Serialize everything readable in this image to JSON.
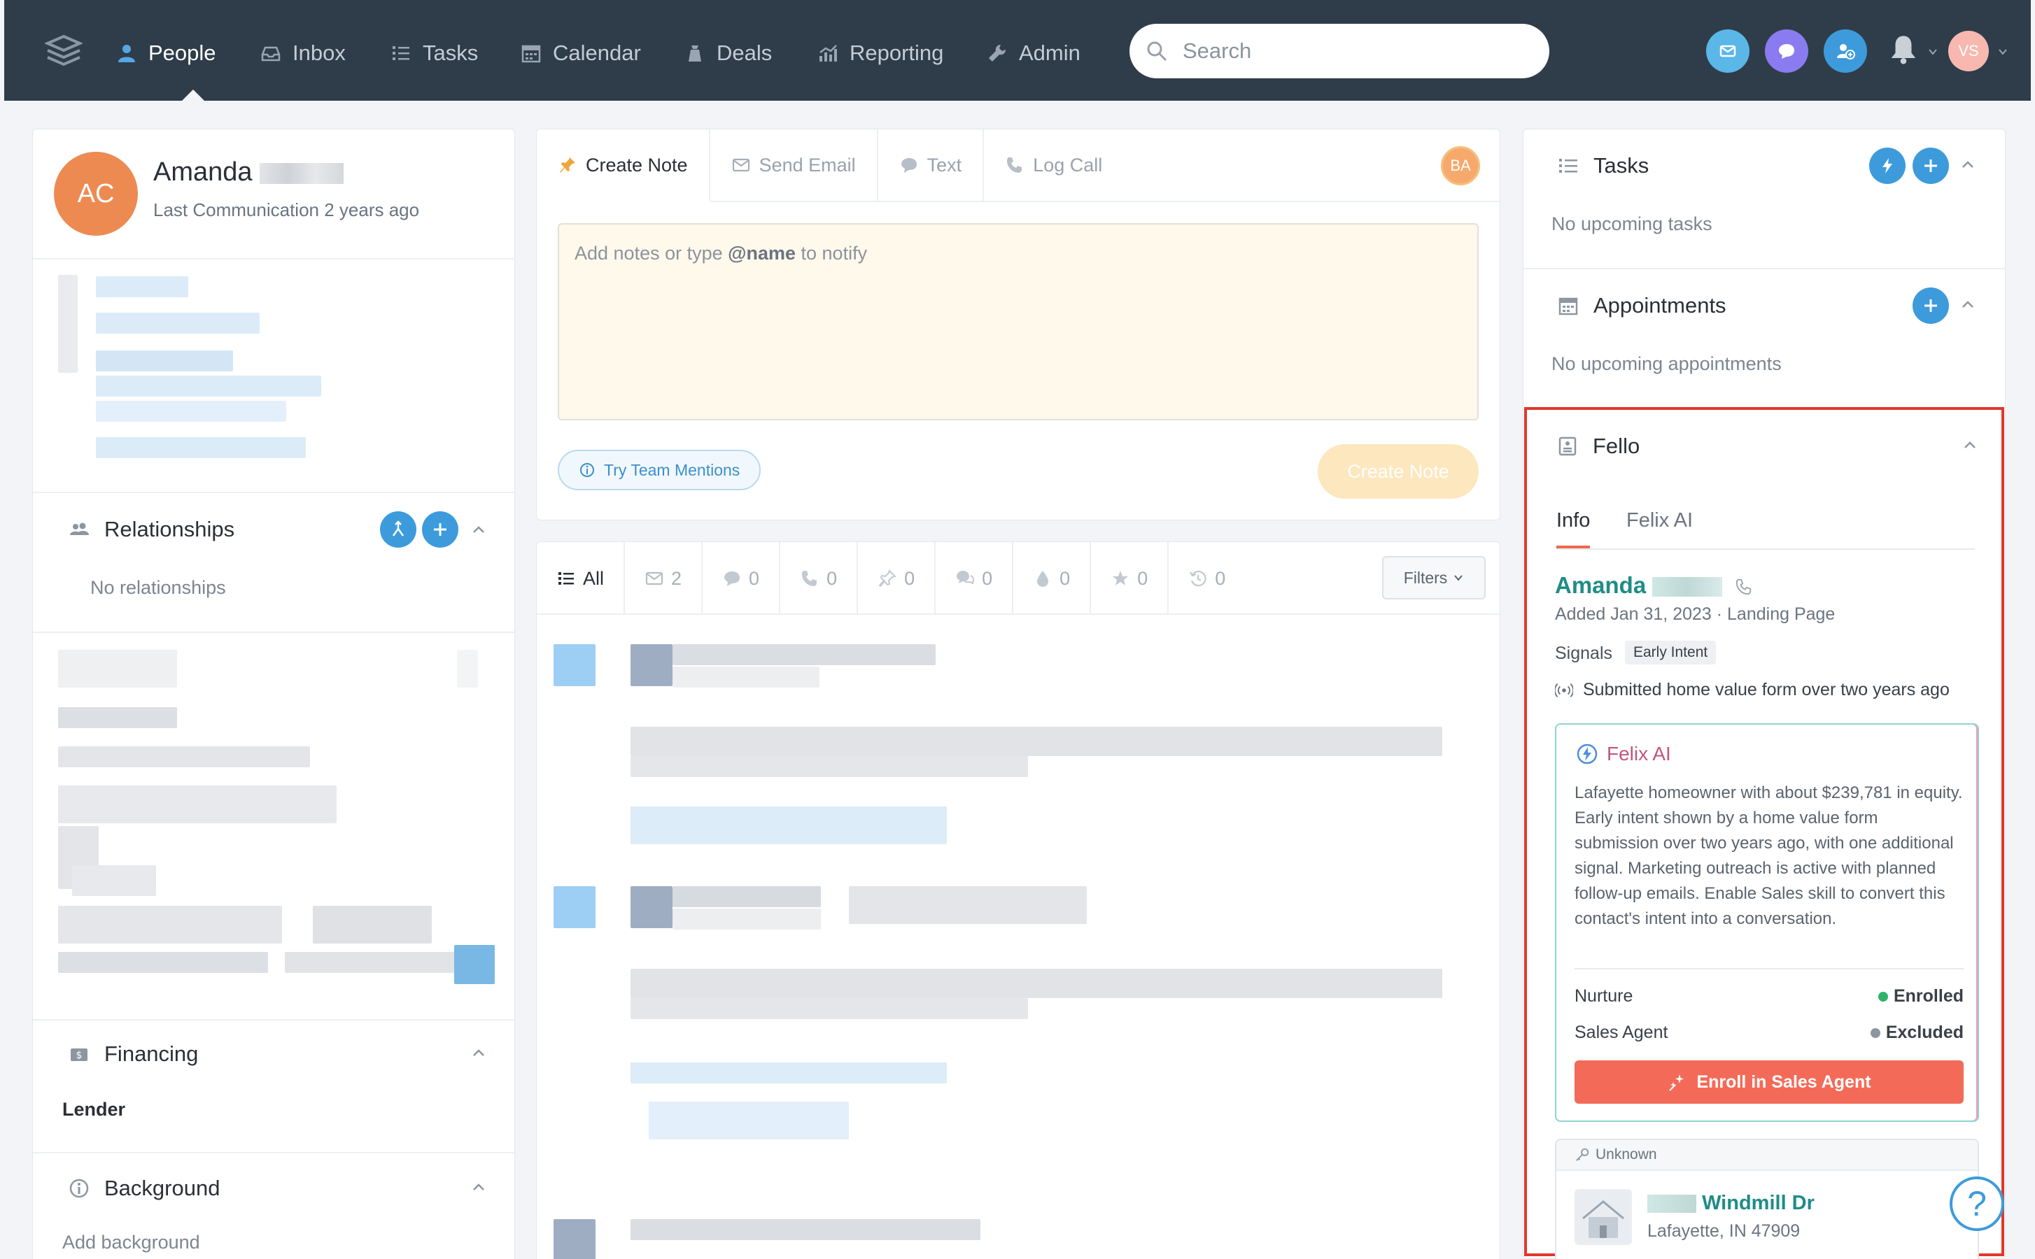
{
  "nav": {
    "items": [
      {
        "label": "People",
        "icon": "person-icon"
      },
      {
        "label": "Inbox",
        "icon": "inbox-icon"
      },
      {
        "label": "Tasks",
        "icon": "list-icon"
      },
      {
        "label": "Calendar",
        "icon": "calendar-icon"
      },
      {
        "label": "Deals",
        "icon": "deals-icon"
      },
      {
        "label": "Reporting",
        "icon": "chart-icon"
      },
      {
        "label": "Admin",
        "icon": "wrench-icon"
      }
    ],
    "search_placeholder": "Search",
    "user_initials": "VS"
  },
  "contact": {
    "initials": "AC",
    "first_name": "Amanda",
    "last_communication": "Last Communication 2 years ago"
  },
  "relationships": {
    "title": "Relationships",
    "empty": "No relationships"
  },
  "financing": {
    "title": "Financing",
    "lender_label": "Lender"
  },
  "background": {
    "title": "Background",
    "placeholder": "Add background"
  },
  "composer": {
    "tabs": [
      "Create Note",
      "Send Email",
      "Text",
      "Log Call"
    ],
    "assignee_initials": "BA",
    "placeholder_pre": "Add notes or type ",
    "placeholder_bold": "@name",
    "placeholder_post": " to notify",
    "mentions_label": "Try Team Mentions",
    "create_label": "Create Note"
  },
  "timeline": {
    "filters": [
      {
        "label": "All",
        "icon": "list-icon"
      },
      {
        "label": "2",
        "icon": "email-icon"
      },
      {
        "label": "0",
        "icon": "chat-icon"
      },
      {
        "label": "0",
        "icon": "phone-icon"
      },
      {
        "label": "0",
        "icon": "pin-icon"
      },
      {
        "label": "0",
        "icon": "messages-icon"
      },
      {
        "label": "0",
        "icon": "drop-icon"
      },
      {
        "label": "0",
        "icon": "star-icon"
      },
      {
        "label": "0",
        "icon": "history-icon"
      }
    ],
    "filters_button": "Filters"
  },
  "tasks": {
    "title": "Tasks",
    "empty": "No upcoming tasks"
  },
  "appointments": {
    "title": "Appointments",
    "empty": "No upcoming appointments"
  },
  "fello": {
    "title": "Fello",
    "tabs": [
      "Info",
      "Felix AI"
    ],
    "lead_name": "Amanda",
    "added": "Added Jan 31, 2023 · Landing Page",
    "signals_label": "Signals",
    "signal_chip": "Early Intent",
    "signal_text": "Submitted home value form over two years ago",
    "ai_title": "Felix AI",
    "ai_summary": "Lafayette homeowner with about $239,781 in equity. Early intent shown by a home value form submission over two years ago, with one additional signal. Marketing outreach is active with planned follow-up emails. Enable Sales skill to convert this contact's intent into a conversation.",
    "nurture_label": "Nurture",
    "nurture_status": "Enrolled",
    "nurture_color": "#2fb36b",
    "sales_label": "Sales Agent",
    "sales_status": "Excluded",
    "sales_color": "#8d96a0",
    "enroll_label": "Enroll in Sales Agent",
    "property_tag": "Unknown",
    "street": "Windmill Dr",
    "city": "Lafayette, IN 47909"
  },
  "help_label": "?"
}
